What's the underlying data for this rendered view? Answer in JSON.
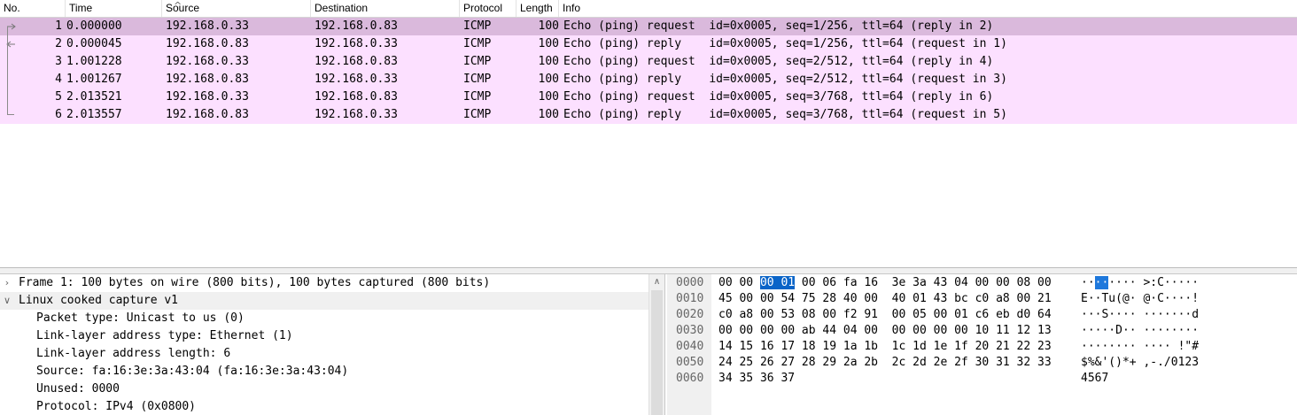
{
  "columns": {
    "no": "No.",
    "time": "Time",
    "source": "Source",
    "destination": "Destination",
    "protocol": "Protocol",
    "length": "Length",
    "info": "Info"
  },
  "packets": [
    {
      "no": "1",
      "time": "0.000000",
      "src": "192.168.0.33",
      "dst": "192.168.0.83",
      "proto": "ICMP",
      "len": "100",
      "info": "Echo (ping) request  id=0x0005, seq=1/256, ttl=64 (reply in 2)"
    },
    {
      "no": "2",
      "time": "0.000045",
      "src": "192.168.0.83",
      "dst": "192.168.0.33",
      "proto": "ICMP",
      "len": "100",
      "info": "Echo (ping) reply    id=0x0005, seq=1/256, ttl=64 (request in 1)"
    },
    {
      "no": "3",
      "time": "1.001228",
      "src": "192.168.0.33",
      "dst": "192.168.0.83",
      "proto": "ICMP",
      "len": "100",
      "info": "Echo (ping) request  id=0x0005, seq=2/512, ttl=64 (reply in 4)"
    },
    {
      "no": "4",
      "time": "1.001267",
      "src": "192.168.0.83",
      "dst": "192.168.0.33",
      "proto": "ICMP",
      "len": "100",
      "info": "Echo (ping) reply    id=0x0005, seq=2/512, ttl=64 (request in 3)"
    },
    {
      "no": "5",
      "time": "2.013521",
      "src": "192.168.0.33",
      "dst": "192.168.0.83",
      "proto": "ICMP",
      "len": "100",
      "info": "Echo (ping) request  id=0x0005, seq=3/768, ttl=64 (reply in 6)"
    },
    {
      "no": "6",
      "time": "2.013557",
      "src": "192.168.0.83",
      "dst": "192.168.0.33",
      "proto": "ICMP",
      "len": "100",
      "info": "Echo (ping) reply    id=0x0005, seq=3/768, ttl=64 (request in 5)"
    }
  ],
  "selected_packet_index": 0,
  "details": [
    {
      "text": "Frame 1: 100 bytes on wire (800 bits), 100 bytes captured (800 bits)",
      "level": 0,
      "toggle": "›"
    },
    {
      "text": "Linux cooked capture v1",
      "level": 0,
      "toggle": "∨"
    },
    {
      "text": "Packet type: Unicast to us (0)",
      "level": 1,
      "toggle": ""
    },
    {
      "text": "Link-layer address type: Ethernet (1)",
      "level": 1,
      "toggle": ""
    },
    {
      "text": "Link-layer address length: 6",
      "level": 1,
      "toggle": ""
    },
    {
      "text": "Source: fa:16:3e:3a:43:04 (fa:16:3e:3a:43:04)",
      "level": 1,
      "toggle": ""
    },
    {
      "text": "Unused: 0000",
      "level": 1,
      "toggle": ""
    },
    {
      "text": "Protocol: IPv4 (0x0800)",
      "level": 1,
      "toggle": ""
    }
  ],
  "bytes": [
    {
      "offset": "0000",
      "hex_pre": "00 00 ",
      "hex_hl": "00 01",
      "hex_post": " 00 06 fa 16  3e 3a 43 04 00 00 08 00",
      "ascii_pre": "··",
      "ascii_hl": "··",
      "ascii_post": "···· >:C·····"
    },
    {
      "offset": "0010",
      "hex_pre": "45 00 00 54 75 28 40 00  40 01 43 bc c0 a8 00 21",
      "hex_hl": "",
      "hex_post": "",
      "ascii_pre": "E··Tu(@· @·C····!",
      "ascii_hl": "",
      "ascii_post": ""
    },
    {
      "offset": "0020",
      "hex_pre": "c0 a8 00 53 08 00 f2 91  00 05 00 01 c6 eb d0 64",
      "hex_hl": "",
      "hex_post": "",
      "ascii_pre": "···S···· ·······d",
      "ascii_hl": "",
      "ascii_post": ""
    },
    {
      "offset": "0030",
      "hex_pre": "00 00 00 00 ab 44 04 00  00 00 00 00 10 11 12 13",
      "hex_hl": "",
      "hex_post": "",
      "ascii_pre": "·····D·· ········",
      "ascii_hl": "",
      "ascii_post": ""
    },
    {
      "offset": "0040",
      "hex_pre": "14 15 16 17 18 19 1a 1b  1c 1d 1e 1f 20 21 22 23",
      "hex_hl": "",
      "hex_post": "",
      "ascii_pre": "········ ···· !\"#",
      "ascii_hl": "",
      "ascii_post": ""
    },
    {
      "offset": "0050",
      "hex_pre": "24 25 26 27 28 29 2a 2b  2c 2d 2e 2f 30 31 32 33",
      "hex_hl": "",
      "hex_post": "",
      "ascii_pre": "$%&'()*+ ,-./0123",
      "ascii_hl": "",
      "ascii_post": ""
    },
    {
      "offset": "0060",
      "hex_pre": "34 35 36 37",
      "hex_hl": "",
      "hex_post": "",
      "ascii_pre": "4567",
      "ascii_hl": "",
      "ascii_post": ""
    }
  ],
  "icons": {
    "sort": "chevron-up-icon",
    "request_marker": "arrow-right-icon",
    "reply_marker": "arrow-left-icon",
    "collapsed": "chevron-right-icon",
    "expanded": "chevron-down-icon",
    "scroll_up": "scroll-up-arrow-icon"
  },
  "colors": {
    "row_bg": "#fce0ff",
    "row_selected_bg": "#dab9dc",
    "byte_highlight": "#0a64c8"
  }
}
